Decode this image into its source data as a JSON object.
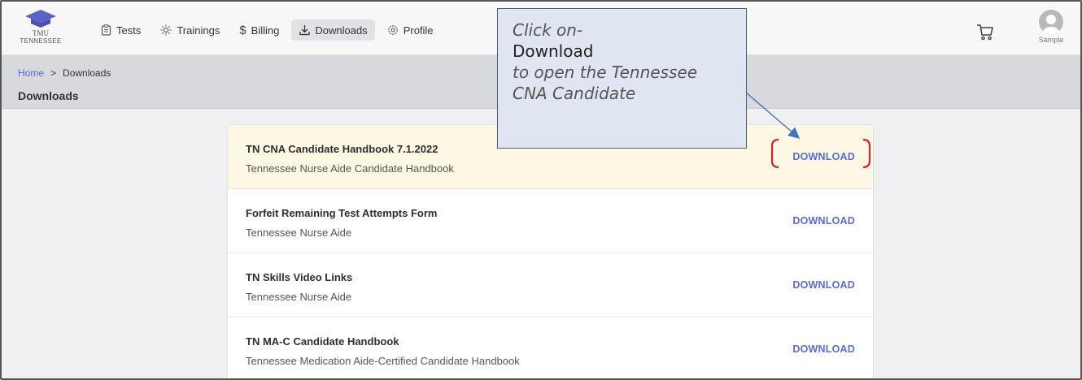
{
  "logo": {
    "line1": "TMU",
    "line2": "TENNESSEE"
  },
  "nav": [
    {
      "label": "Tests",
      "icon": "clipboard-icon"
    },
    {
      "label": "Trainings",
      "icon": "lightbulb-icon"
    },
    {
      "label": "Billing",
      "icon": "dollar-icon"
    },
    {
      "label": "Downloads",
      "icon": "download-icon",
      "active": true
    },
    {
      "label": "Profile",
      "icon": "gear-icon"
    }
  ],
  "header": {
    "cart_icon": "cart-icon",
    "user_name": "Sample"
  },
  "breadcrumb": {
    "home": "Home",
    "separator": ">",
    "current": "Downloads"
  },
  "page_title": "Downloads",
  "downloads": [
    {
      "title": "TN CNA Candidate Handbook 7.1.2022",
      "subtitle": "Tennessee Nurse Aide Candidate Handbook",
      "action": "DOWNLOAD",
      "highlighted": true
    },
    {
      "title": "Forfeit Remaining Test Attempts Form",
      "subtitle": "Tennessee Nurse Aide",
      "action": "DOWNLOAD"
    },
    {
      "title": "TN Skills Video Links",
      "subtitle": "Tennessee Nurse Aide",
      "action": "DOWNLOAD"
    },
    {
      "title": "TN MA-C Candidate Handbook",
      "subtitle": "Tennessee Medication Aide-Certified Candidate Handbook",
      "action": "DOWNLOAD"
    }
  ],
  "callout": {
    "line1": "Click on-",
    "line2": "Download",
    "line3": "to open the Tennessee",
    "line4": "CNA Candidate"
  },
  "colors": {
    "accent": "#5b6bd4",
    "link": "#4f6bd6",
    "highlight_row": "#fdf8e4",
    "callout_bg": "#dfe6f2",
    "annotation_red": "#e02020",
    "arrow": "#4472c4"
  }
}
